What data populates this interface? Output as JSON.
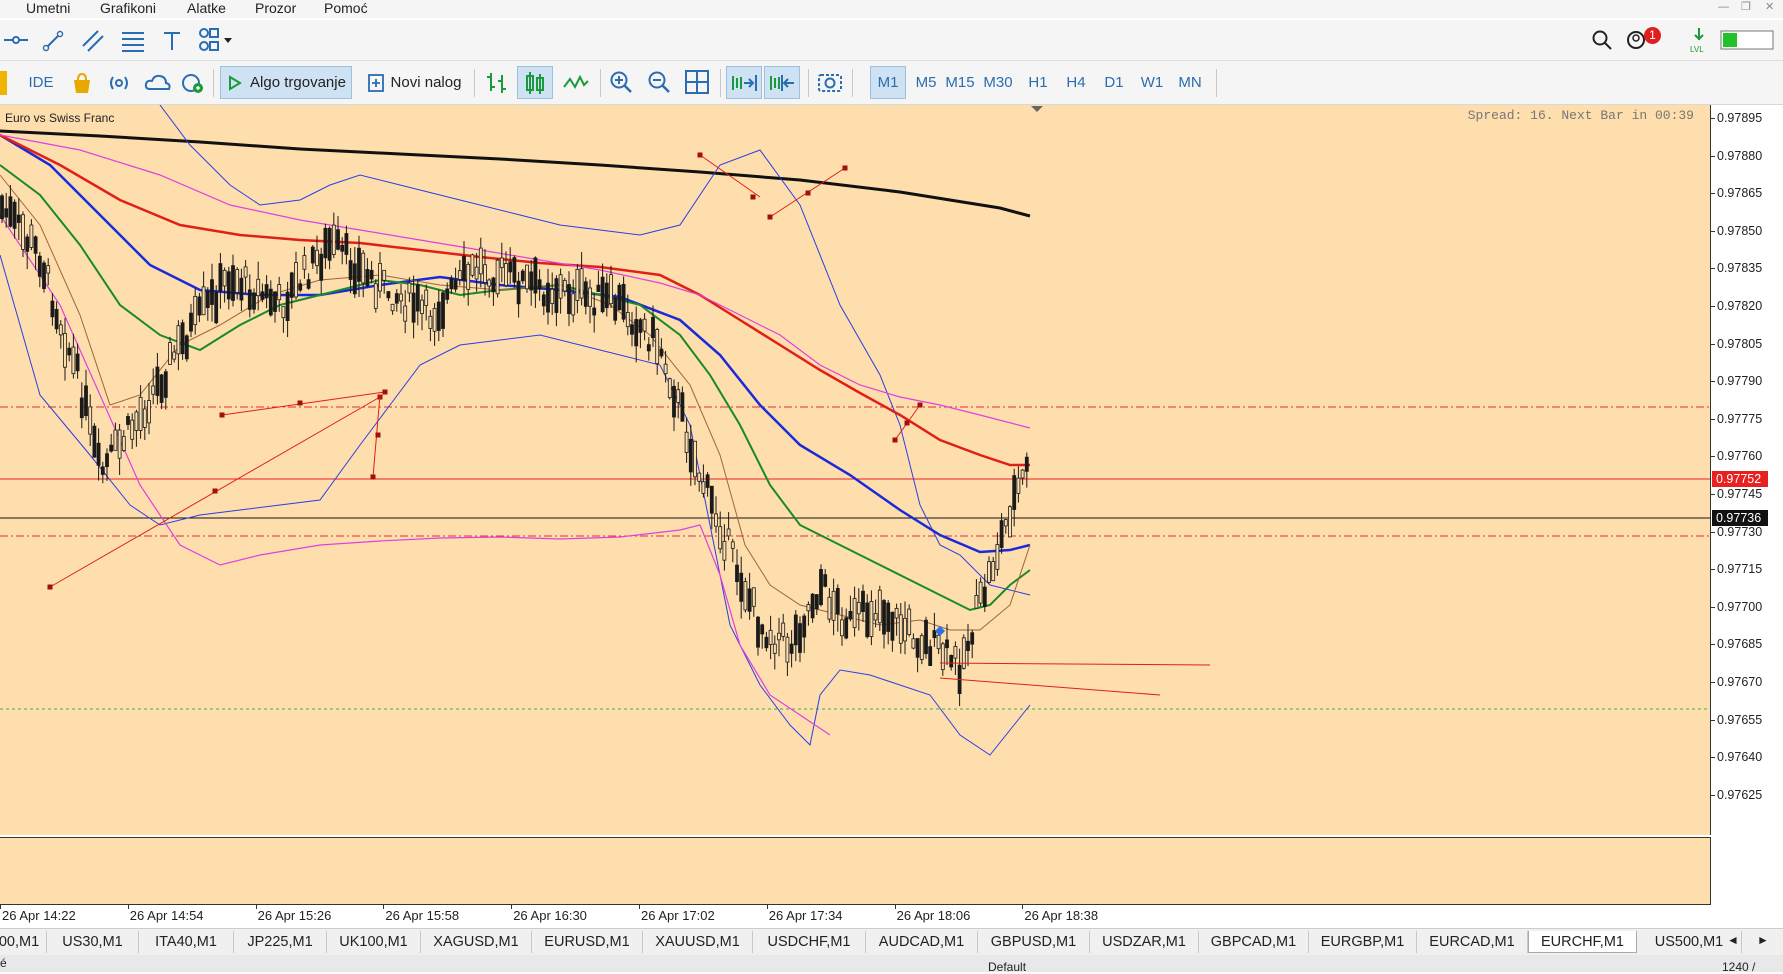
{
  "menu": [
    "Umetni",
    "Grafikoni",
    "Alatke",
    "Prozor",
    "Pomoć"
  ],
  "window_controls": [
    "—",
    "❐",
    "✕"
  ],
  "toolbar_top": {
    "icons": [
      "horizontal-line-icon",
      "trendline-icon",
      "channel-icon",
      "fibonacci-icon",
      "text-icon",
      "shapes-icon"
    ],
    "notifications_count": "1",
    "right_icons": [
      "search-icon",
      "account-icon",
      "signal-icon",
      "battery-icon"
    ]
  },
  "toolbar": {
    "ide_label": "IDE",
    "algo_label": "Algo trgovanje",
    "new_order_label": "Novi nalog",
    "timeframes": [
      "M1",
      "M5",
      "M15",
      "M30",
      "H1",
      "H4",
      "D1",
      "W1",
      "MN"
    ],
    "active_timeframe": "M1"
  },
  "chart": {
    "symbol_title": "Euro vs Swiss Franc",
    "spread_text": "Spread: 16. Next Bar in 00:39",
    "background_color": "#fddeac",
    "price_ticks": [
      "0.97895",
      "0.97880",
      "0.97865",
      "0.97850",
      "0.97835",
      "0.97820",
      "0.97805",
      "0.97790",
      "0.97775",
      "0.97760",
      "0.97745",
      "0.97730",
      "0.97715",
      "0.97700",
      "0.97685",
      "0.97670",
      "0.97655",
      "0.97640",
      "0.97625"
    ],
    "ask_price": "0.97752",
    "bid_price": "0.97736",
    "ask_color": "#e8201f",
    "bid_color": "#111111",
    "time_ticks": [
      "26 Apr 14:22",
      "26 Apr 14:54",
      "26 Apr 15:26",
      "26 Apr 15:58",
      "26 Apr 16:30",
      "26 Apr 17:02",
      "26 Apr 17:34",
      "26 Apr 18:06",
      "26 Apr 18:38"
    ]
  },
  "symbol_tabs": [
    "00,M1",
    "US30,M1",
    "ITA40,M1",
    "JP225,M1",
    "UK100,M1",
    "XAGUSD,M1",
    "EURUSD,M1",
    "XAUUSD,M1",
    "USDCHF,M1",
    "AUDCAD,M1",
    "GBPUSD,M1",
    "USDZAR,M1",
    "GBPCAD,M1",
    "EURGBP,M1",
    "EURCAD,M1",
    "EURCHF,M1",
    "US500,M1"
  ],
  "active_tab": "EURCHF,M1",
  "statusbar": {
    "left": "é",
    "profile": "Default",
    "right": "1240 /"
  }
}
